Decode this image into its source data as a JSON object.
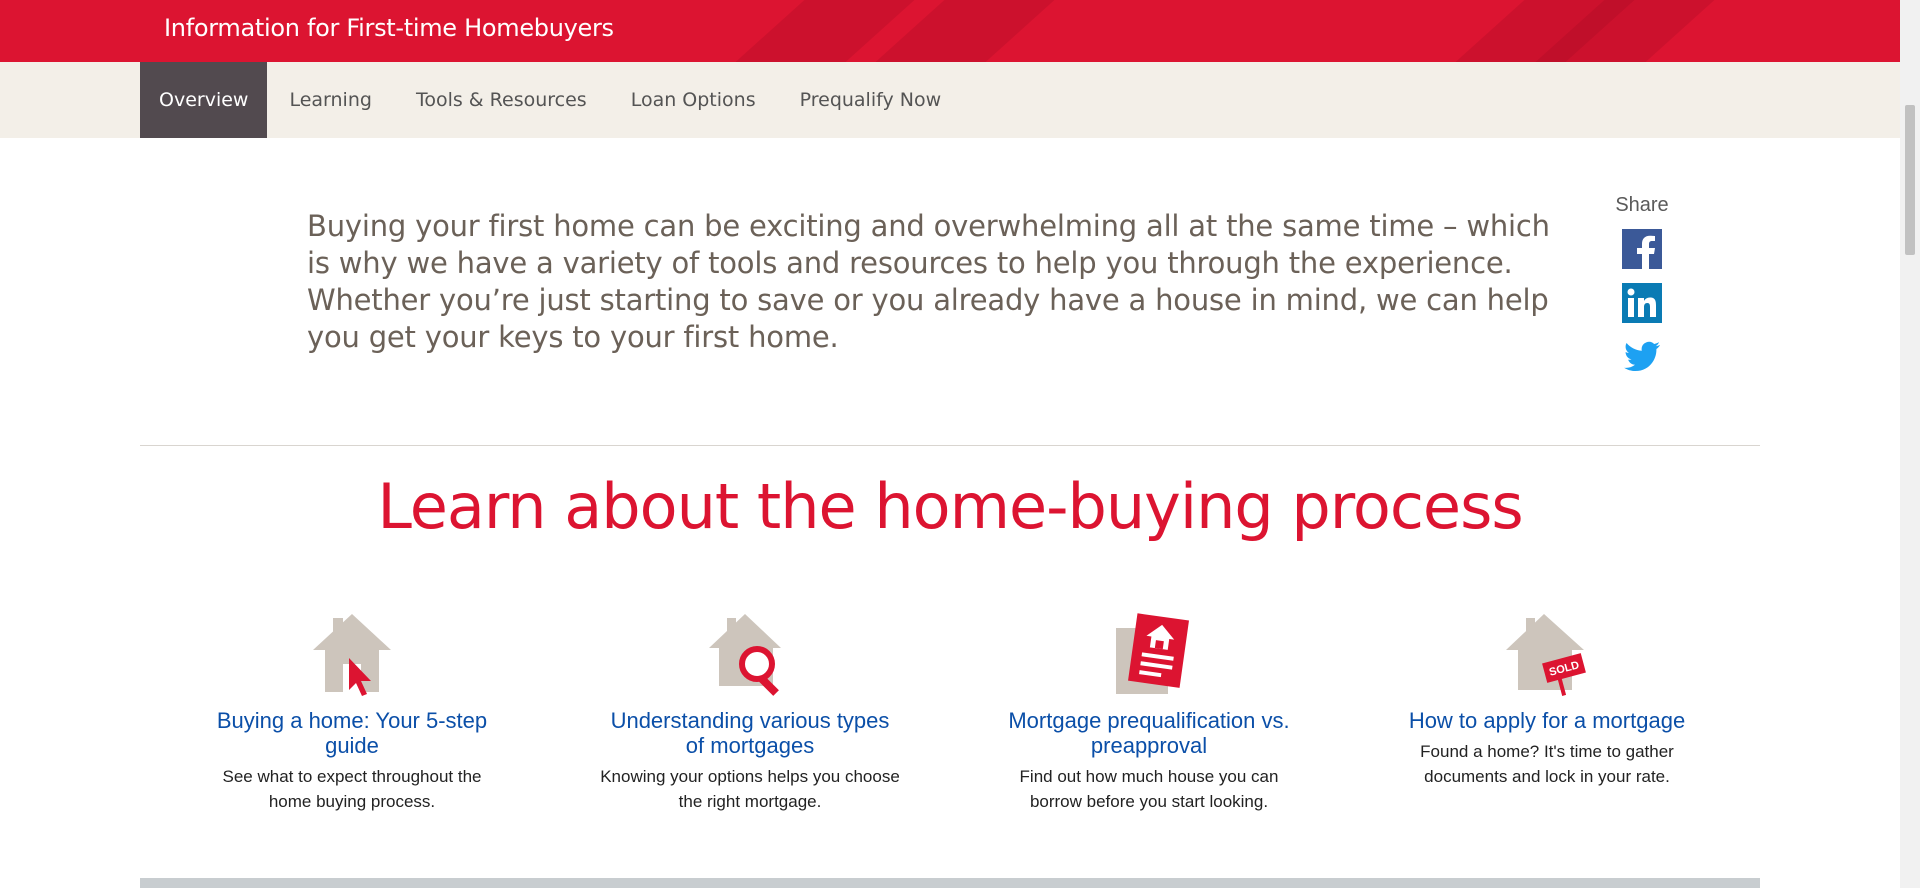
{
  "banner": {
    "title": "Information for First-time Homebuyers"
  },
  "nav": {
    "tabs": [
      {
        "label": "Overview"
      },
      {
        "label": "Learning"
      },
      {
        "label": "Tools & Resources"
      },
      {
        "label": "Loan Options"
      },
      {
        "label": "Prequalify Now"
      }
    ],
    "active": "Overview"
  },
  "intro": {
    "text": "Buying your first home can be exciting and overwhelming all at the same time – which is why we have a variety of tools and resources to help you through the experience. Whether you’re just starting to save or you already have a house in mind, we can help you get your keys to your first home."
  },
  "share": {
    "label": "Share",
    "icons": [
      "facebook-icon",
      "linkedin-icon",
      "twitter-icon"
    ]
  },
  "section": {
    "title": "Learn about the home-buying process"
  },
  "cards": [
    {
      "icon": "house-cursor-icon",
      "title": "Buying a home: Your 5-step guide",
      "description": "See what to expect throughout the home buying process."
    },
    {
      "icon": "house-magnifier-icon",
      "title": "Understanding various types of mortgages",
      "description": "Knowing your options helps you choose the right mortgage."
    },
    {
      "icon": "document-house-icon",
      "title": "Mortgage prequalification vs. preapproval",
      "description": "Find out how much house you can borrow before you start looking."
    },
    {
      "icon": "house-sold-sign-icon",
      "title": "How to apply for a mortgage",
      "description": "Found a home? It's time to gather documents and lock in your rate.",
      "sign_text": "SOLD"
    }
  ],
  "colors": {
    "brand_red": "#dc1431",
    "nav_bg": "#f3efe8",
    "active_tab": "#524a4f",
    "link_blue": "#0b4fa8",
    "icon_beige": "#cdc5bc"
  }
}
